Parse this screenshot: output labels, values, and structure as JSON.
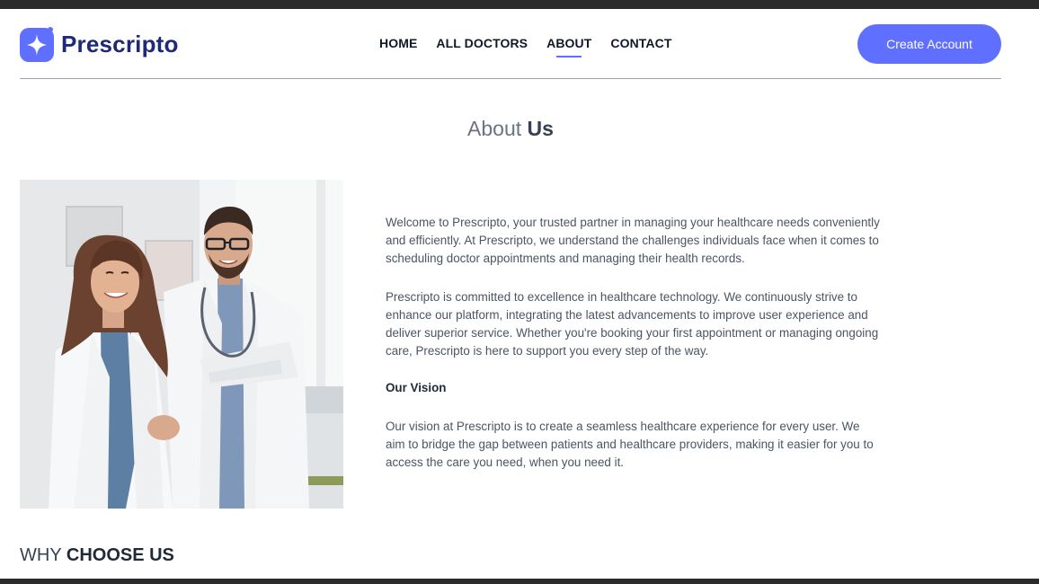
{
  "brand": {
    "name": "Prescripto",
    "accent_color": "#5f6fff",
    "text_color": "#1e2a78"
  },
  "nav": {
    "items": [
      {
        "label": "HOME",
        "active": false
      },
      {
        "label": "ALL DOCTORS",
        "active": false
      },
      {
        "label": "ABOUT",
        "active": true
      },
      {
        "label": "CONTACT",
        "active": false
      }
    ]
  },
  "header": {
    "cta_label": "Create Account"
  },
  "about": {
    "title_prefix": "About",
    "title_emphasis": "Us",
    "image_icon": "doctors-photo",
    "paragraph1": "Welcome to Prescripto, your trusted partner in managing your healthcare needs conveniently and efficiently. At Prescripto, we understand the challenges individuals face when it comes to scheduling doctor appointments and managing their health records.",
    "paragraph2": "Prescripto is committed to excellence in healthcare technology. We continuously strive to enhance our platform, integrating the latest advancements to improve user experience and deliver superior service. Whether you're booking your first appointment or managing ongoing care, Prescripto is here to support you every step of the way.",
    "vision_heading": "Our Vision",
    "vision_text": "Our vision at Prescripto is to create a seamless healthcare experience for every user. We aim to bridge the gap between patients and healthcare providers, making it easier for you to access the care you need, when you need it."
  },
  "why": {
    "prefix": "WHY",
    "emphasis": "CHOOSE US"
  }
}
